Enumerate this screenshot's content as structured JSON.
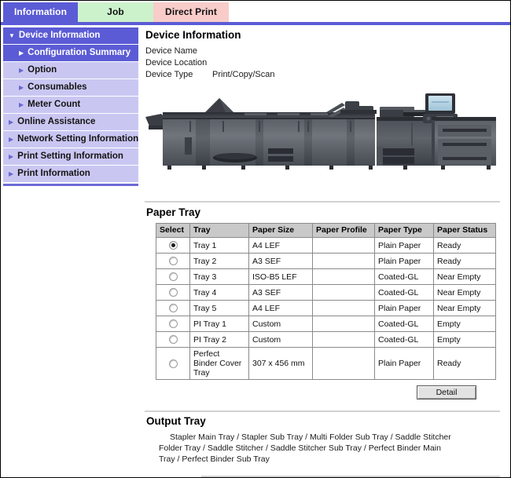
{
  "tabs": [
    {
      "id": "information",
      "label": "Information",
      "active": true,
      "color": "#5b5bd6"
    },
    {
      "id": "job",
      "label": "Job",
      "active": false,
      "color": "#ccf2cc"
    },
    {
      "id": "direct-print",
      "label": "Direct Print",
      "active": false,
      "color": "#f8ccc9"
    }
  ],
  "sidebar": {
    "items": [
      {
        "label": "Device Information",
        "level": 0,
        "state": "selected",
        "icon": "triangle-down-icon",
        "glyph": "▼"
      },
      {
        "label": "Configuration Summary",
        "level": 1,
        "state": "selected",
        "icon": "triangle-right-icon",
        "glyph": "▶"
      },
      {
        "label": "Option",
        "level": 1,
        "state": "normal",
        "icon": "triangle-right-icon",
        "glyph": "▶"
      },
      {
        "label": "Consumables",
        "level": 1,
        "state": "normal",
        "icon": "triangle-right-icon",
        "glyph": "▶"
      },
      {
        "label": "Meter Count",
        "level": 1,
        "state": "normal",
        "icon": "triangle-right-icon",
        "glyph": "▶"
      },
      {
        "label": "Online Assistance",
        "level": 0,
        "state": "normal",
        "icon": "triangle-right-icon",
        "glyph": "▶"
      },
      {
        "label": "Network Setting Information",
        "level": 0,
        "state": "normal",
        "icon": "triangle-right-icon",
        "glyph": "▶"
      },
      {
        "label": "Print Setting Information",
        "level": 0,
        "state": "normal",
        "icon": "triangle-right-icon",
        "glyph": "▶"
      },
      {
        "label": "Print Information",
        "level": 0,
        "state": "normal",
        "icon": "triangle-right-icon",
        "glyph": "▶"
      }
    ]
  },
  "device_information": {
    "heading": "Device Information",
    "fields": [
      {
        "label": "Device Name",
        "value": ""
      },
      {
        "label": "Device Location",
        "value": ""
      },
      {
        "label": "Device Type",
        "value": "Print/Copy/Scan"
      }
    ],
    "illustration": "production-printer-illustration"
  },
  "paper_tray": {
    "heading": "Paper Tray",
    "columns": [
      "Select",
      "Tray",
      "Paper Size",
      "Paper Profile",
      "Paper Type",
      "Paper Status"
    ],
    "rows": [
      {
        "selected": true,
        "tray": "Tray 1",
        "size": "A4 LEF",
        "profile": "",
        "type": "Plain Paper",
        "status": "Ready"
      },
      {
        "selected": false,
        "tray": "Tray 2",
        "size": "A3 SEF",
        "profile": "",
        "type": "Plain Paper",
        "status": "Ready"
      },
      {
        "selected": false,
        "tray": "Tray 3",
        "size": "ISO-B5 LEF",
        "profile": "",
        "type": "Coated-GL",
        "status": "Near Empty"
      },
      {
        "selected": false,
        "tray": "Tray 4",
        "size": "A3 SEF",
        "profile": "",
        "type": "Coated-GL",
        "status": "Near Empty"
      },
      {
        "selected": false,
        "tray": "Tray 5",
        "size": "A4 LEF",
        "profile": "",
        "type": "Plain Paper",
        "status": "Near Empty"
      },
      {
        "selected": false,
        "tray": "PI Tray 1",
        "size": "Custom",
        "profile": "",
        "type": "Coated-GL",
        "status": "Empty"
      },
      {
        "selected": false,
        "tray": "PI Tray 2",
        "size": "Custom",
        "profile": "",
        "type": "Coated-GL",
        "status": "Empty"
      },
      {
        "selected": false,
        "tray": "Perfect Binder Cover Tray",
        "size": "307 x 456 mm",
        "profile": "",
        "type": "Plain Paper",
        "status": "Ready"
      }
    ],
    "detail_button": "Detail"
  },
  "output_tray": {
    "heading": "Output Tray",
    "value": "Stapler Main Tray / Stapler Sub Tray / Multi Folder Sub Tray / Saddle Stitcher Folder Tray / Saddle Stitcher / Saddle Stitcher Sub Tray / Perfect Binder Main Tray / Perfect Binder Sub Tray"
  }
}
